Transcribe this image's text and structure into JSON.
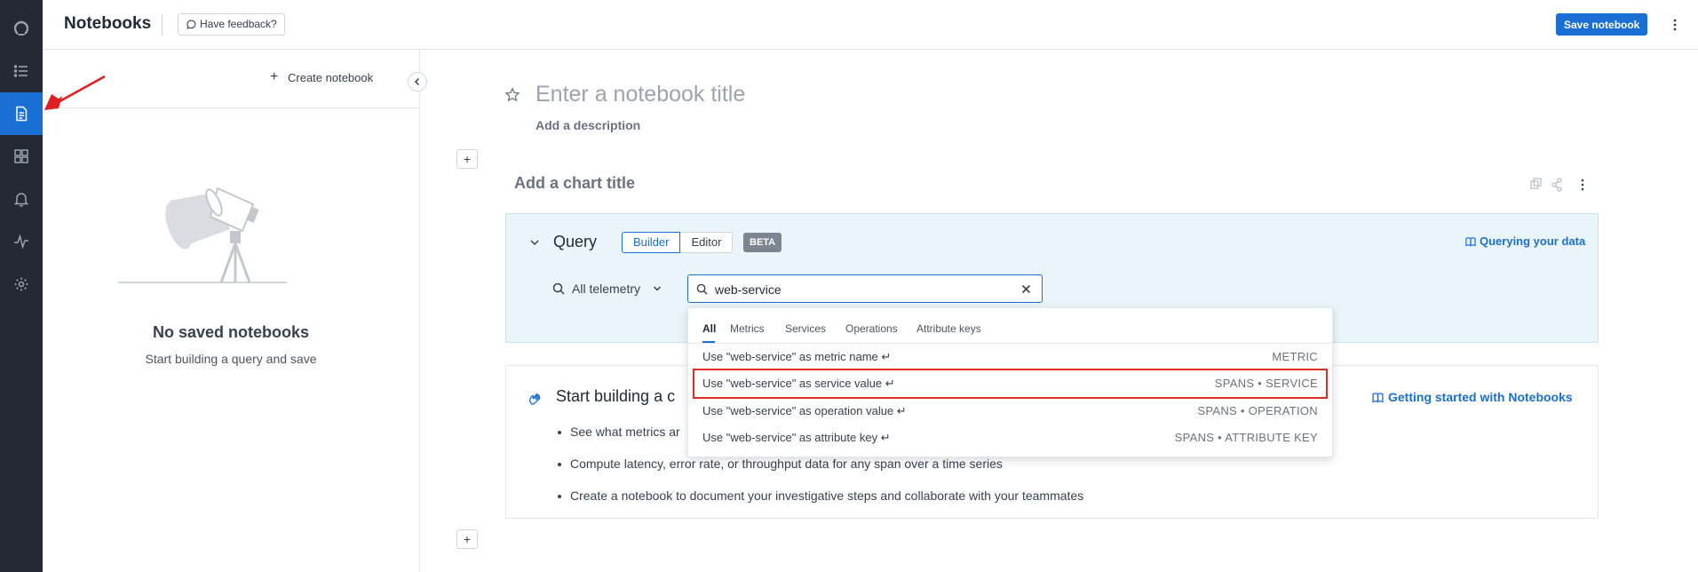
{
  "app": {
    "title": "Notebooks",
    "feedback_label": "Have feedback?",
    "save_label": "Save notebook",
    "accent": "#1a6fd4"
  },
  "rail": {
    "items": [
      {
        "icon": "logo-icon"
      },
      {
        "icon": "list-icon"
      },
      {
        "icon": "notebook-icon",
        "active": true
      },
      {
        "icon": "dashboard-grid-icon"
      },
      {
        "icon": "bell-icon"
      },
      {
        "icon": "pulse-icon"
      },
      {
        "icon": "gear-icon"
      }
    ]
  },
  "sidebar": {
    "create_label": "Create notebook",
    "empty_title": "No saved notebooks",
    "empty_subtitle": "Start building a query and save"
  },
  "notebook": {
    "title_placeholder": "Enter a notebook title",
    "description_placeholder": "Add a description",
    "chart_title_placeholder": "Add a chart title"
  },
  "query": {
    "label": "Query",
    "modes": [
      "Builder",
      "Editor"
    ],
    "active_mode": "Builder",
    "badge": "BETA",
    "docs_link": "Querying your data",
    "scope": "All telemetry",
    "search_value": "web-service"
  },
  "dropdown": {
    "tabs": [
      "All",
      "Metrics",
      "Services",
      "Operations",
      "Attribute keys"
    ],
    "active_tab": "All",
    "items": [
      {
        "label": "Use \"web-service\" as metric name ↵",
        "type": "METRIC"
      },
      {
        "label": "Use \"web-service\" as service value ↵",
        "type": "SPANS • SERVICE",
        "highlighted": true
      },
      {
        "label": "Use \"web-service\" as operation value ↵",
        "type": "SPANS • OPERATION"
      },
      {
        "label": "Use \"web-service\" as attribute key ↵",
        "type": "SPANS • ATTRIBUTE KEY"
      }
    ],
    "highlight_color": "#d93025"
  },
  "getting_started": {
    "title": "Start building a c",
    "link": "Getting started with Notebooks",
    "bullets": [
      "See what metrics ar",
      "Compute latency, error rate, or throughput data for any span over a time series",
      "Create a notebook to document your investigative steps and collaborate with your teammates"
    ]
  }
}
